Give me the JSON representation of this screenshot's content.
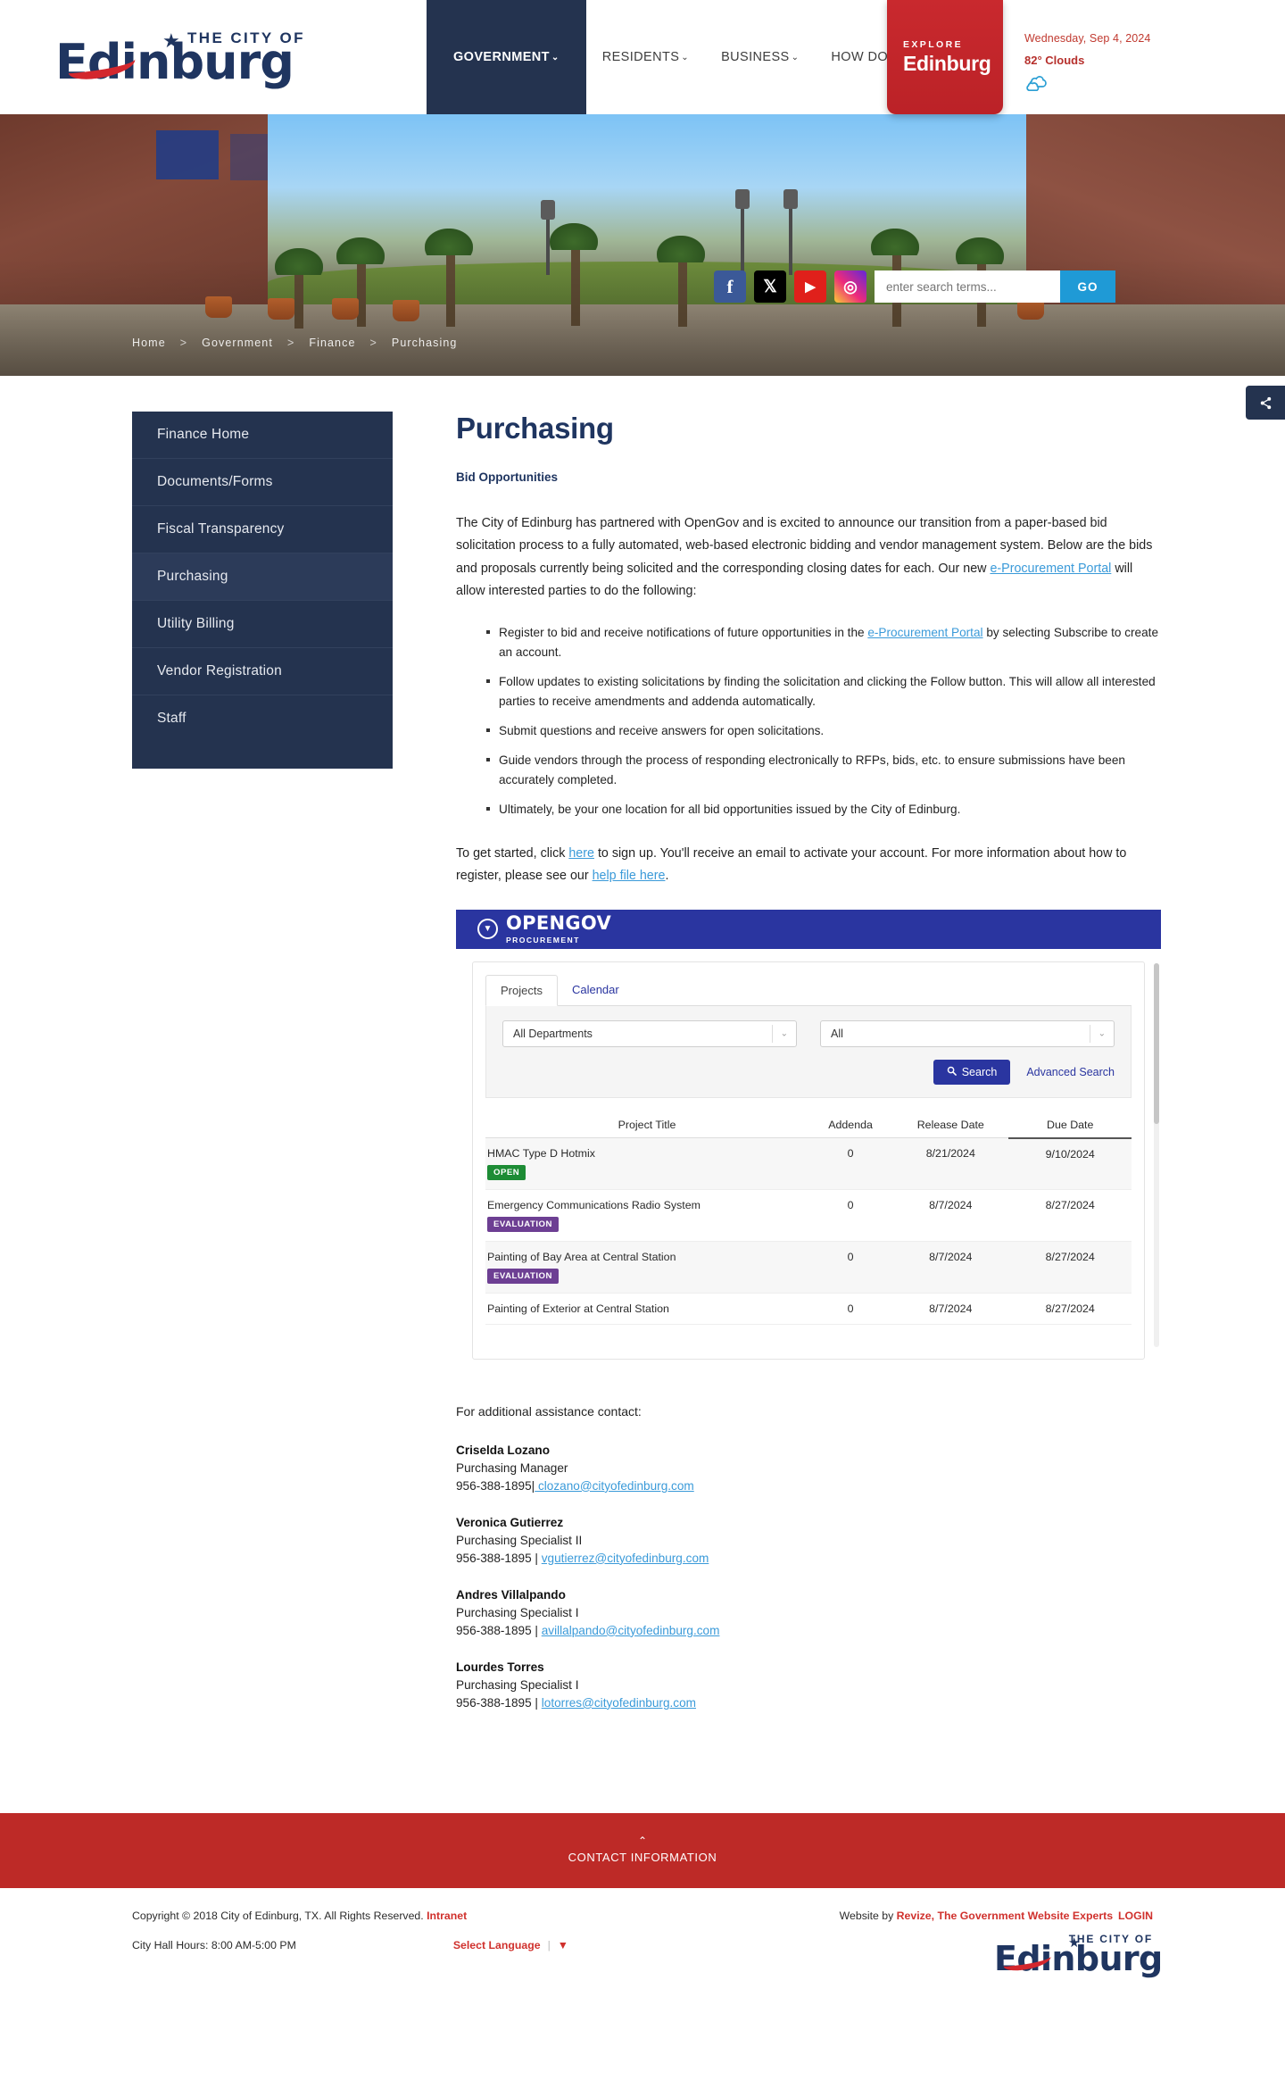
{
  "header": {
    "logo": {
      "city_of": "THE CITY OF",
      "name": "Edinburg",
      "star": "★"
    },
    "nav": [
      {
        "label": "GOVERNMENT",
        "caret": "⌄",
        "active": true
      },
      {
        "label": "RESIDENTS",
        "caret": "⌄",
        "active": false
      },
      {
        "label": "BUSINESS",
        "caret": "⌄",
        "active": false
      },
      {
        "label": "HOW DO I",
        "caret": "⌄",
        "active": false
      }
    ],
    "explore": {
      "small": "EXPLORE",
      "big": "Edinburg"
    },
    "weather": {
      "date": "Wednesday, Sep 4, 2024",
      "temp": "82° Clouds",
      "icon": "cloud-icon"
    }
  },
  "hero": {
    "social": [
      {
        "name": "facebook-icon",
        "glyph": "f"
      },
      {
        "name": "twitter-x-icon",
        "glyph": "𝕏"
      },
      {
        "name": "youtube-icon",
        "glyph": "▶"
      },
      {
        "name": "instagram-icon",
        "glyph": "◎"
      }
    ],
    "search": {
      "placeholder": "enter search terms...",
      "value": "",
      "go_label": "GO"
    },
    "breadcrumb": [
      "Home",
      "Government",
      "Finance",
      "Purchasing"
    ],
    "breadcrumb_sep": ">"
  },
  "share": {
    "icon": "share-icon",
    "glyph": "❮"
  },
  "sidebar": {
    "items": [
      {
        "label": "Finance Home",
        "active": false
      },
      {
        "label": "Documents/Forms",
        "active": false
      },
      {
        "label": "Fiscal Transparency",
        "active": false
      },
      {
        "label": "Purchasing",
        "active": true
      },
      {
        "label": "Utility Billing",
        "active": false
      },
      {
        "label": "Vendor Registration",
        "active": false
      },
      {
        "label": "Staff",
        "active": false
      }
    ]
  },
  "main": {
    "title": "Purchasing",
    "subhead": "Bid Opportunities",
    "intro_p1": "The City of Edinburg has partnered with OpenGov and is excited to announce our transition from a paper-based bid solicitation process to a fully automated, web-based electronic bidding and vendor management system. Below are the bids and proposals currently being solicited and the corresponding closing dates for each. Our new ",
    "intro_link": "e-Procurement Portal",
    "intro_p2": " will allow interested parties to do the following:",
    "bullets": [
      {
        "pre": "Register to bid and receive notifications of future opportunities in the ",
        "link": "e-Procurement Portal",
        "post": " by selecting Subscribe to create an account."
      },
      {
        "pre": "Follow updates to existing solicitations by finding the solicitation and clicking the Follow button. This will allow all interested parties to receive amendments and addenda automatically.",
        "link": "",
        "post": ""
      },
      {
        "pre": "Submit questions and receive answers for open solicitations.",
        "link": "",
        "post": ""
      },
      {
        "pre": "Guide vendors through the process of responding electronically to RFPs, bids, etc. to ensure submissions have been accurately completed.",
        "link": "",
        "post": ""
      },
      {
        "pre": "Ultimately, be your one location for all bid opportunities issued by the City of Edinburg.",
        "link": "",
        "post": ""
      }
    ],
    "getstarted_p1": "To get started, click ",
    "getstarted_link1": "here",
    "getstarted_p2": " to sign up. You'll receive an email to activate your account. For more information about how to register, please see our ",
    "getstarted_link2": "help file here",
    "getstarted_p3": "."
  },
  "opengov": {
    "brand": "OPENGOV",
    "brand_sub": "PROCUREMENT",
    "tabs": [
      {
        "label": "Projects",
        "active": true
      },
      {
        "label": "Calendar",
        "active": false
      }
    ],
    "department_select": "All Departments",
    "status_select": "All",
    "search_button": "Search",
    "search_icon": "🔍",
    "advanced_search": "Advanced Search",
    "columns": [
      "Project Title",
      "Addenda",
      "Release Date",
      "Due Date"
    ],
    "sorted_column": "Due Date",
    "rows": [
      {
        "title": "HMAC Type D Hotmix",
        "badge": "OPEN",
        "badge_kind": "open",
        "addenda": "0",
        "release": "8/21/2024",
        "due": "9/10/2024"
      },
      {
        "title": "Emergency Communications Radio System",
        "badge": "EVALUATION",
        "badge_kind": "evaluation",
        "addenda": "0",
        "release": "8/7/2024",
        "due": "8/27/2024"
      },
      {
        "title": "Painting of Bay Area at Central Station",
        "badge": "EVALUATION",
        "badge_kind": "evaluation",
        "addenda": "0",
        "release": "8/7/2024",
        "due": "8/27/2024"
      },
      {
        "title": "Painting of Exterior at Central Station",
        "badge": "",
        "badge_kind": "",
        "addenda": "0",
        "release": "8/7/2024",
        "due": "8/27/2024"
      }
    ]
  },
  "contacts": {
    "intro": "For additional assistance contact:",
    "people": [
      {
        "name": "Criselda Lozano",
        "title": "Purchasing Manager",
        "phone": "956-388-1895|",
        "email": " clozano@cityofedinburg.com"
      },
      {
        "name": "Veronica Gutierrez",
        "title": "Purchasing Specialist II",
        "phone": "956-388-1895 | ",
        "email": "vgutierrez@cityofedinburg.com"
      },
      {
        "name": "Andres Villalpando",
        "title": "Purchasing Specialist I",
        "phone": "956-388-1895 | ",
        "email": "avillalpando@cityofedinburg.com"
      },
      {
        "name": "Lourdes Torres",
        "title": "Purchasing Specialist I",
        "phone": "956-388-1895 | ",
        "email": "lotorres@cityofedinburg.com"
      }
    ]
  },
  "footer": {
    "contact_bar": {
      "chev": "⌃",
      "label": "CONTACT INFORMATION"
    },
    "copyright": "Copyright © 2018 City of Edinburg, TX. All Rights Reserved. ",
    "intranet": "Intranet",
    "hours": "City Hall Hours: 8:00 AM-5:00 PM",
    "language": "Select Language",
    "language_bar": "|",
    "language_caret": "▼",
    "website_by_pre": "Website by ",
    "website_by_brand": "Revize, The Government Website Experts",
    "login": "LOGIN",
    "logo": {
      "city_of": "THE CITY OF",
      "name": "Edinburg",
      "star": "★"
    }
  },
  "colors": {
    "navy": "#24334f",
    "brand_navy": "#1f3560",
    "red": "#bd2a27",
    "link_blue": "#3a9ad9",
    "opengov_blue": "#2a35a0",
    "badge_open": "#1d8c35",
    "badge_evaluation": "#6d3f93",
    "go_blue": "#1f9ad6"
  }
}
